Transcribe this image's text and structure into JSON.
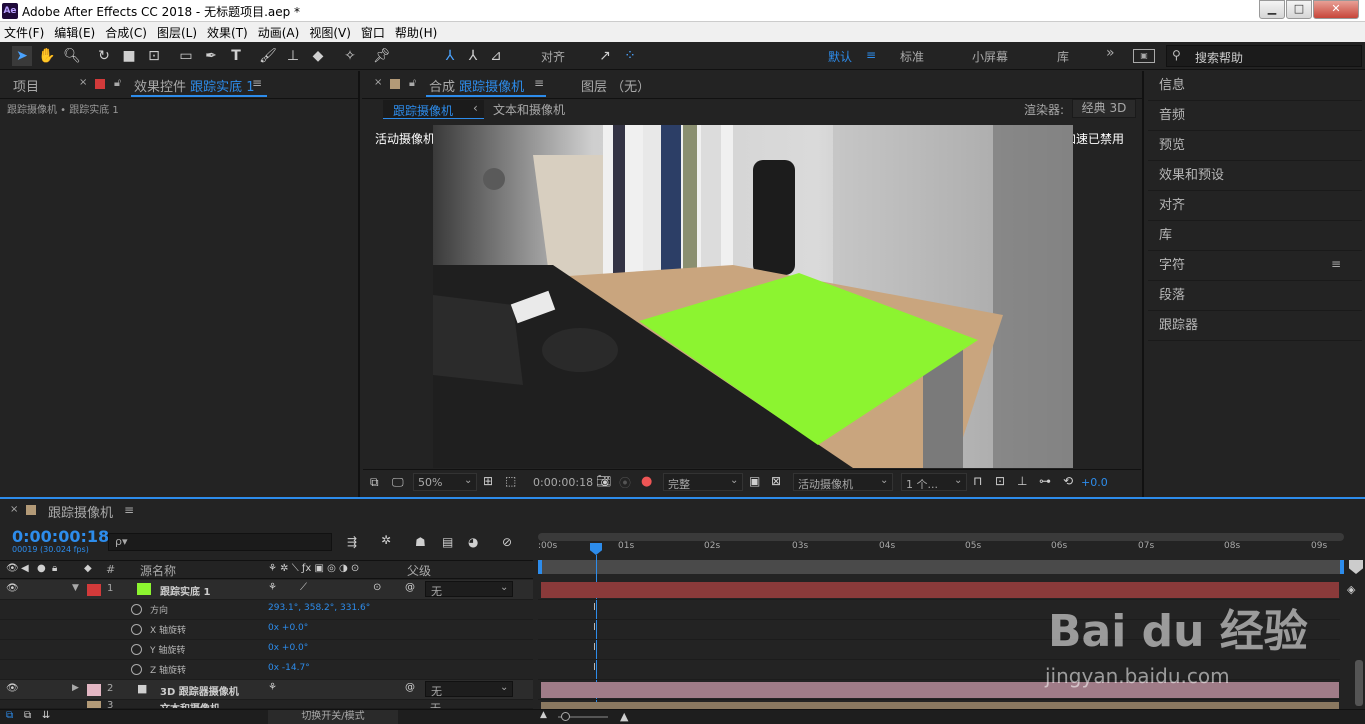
{
  "titlebar": {
    "app_icon": "Ae",
    "title": "Adobe After Effects CC 2018 - 无标题项目.aep *",
    "minimize": "▁",
    "maximize": "□",
    "close": "✕"
  },
  "menubar": {
    "items": [
      "文件(F)",
      "编辑(E)",
      "合成(C)",
      "图层(L)",
      "效果(T)",
      "动画(A)",
      "视图(V)",
      "窗口",
      "帮助(H)"
    ]
  },
  "toolbar": {
    "align_label": "对齐",
    "workspaces": [
      "默认",
      "标准",
      "小屏幕",
      "库"
    ],
    "more": "»",
    "search_placeholder": "搜索帮助"
  },
  "left_panel": {
    "tab_project": "项目",
    "tab_effects_prefix": "效果控件",
    "tab_effects_layer": "跟踪实底 1",
    "breadcrumb": "跟踪摄像机 • 跟踪实底 1"
  },
  "comp_panel": {
    "tab_prefix": "合成",
    "tab_name": "跟踪摄像机",
    "tab_layer": "图层 （无）",
    "sub_tab_active": "跟踪摄像机",
    "sub_tab_other": "文本和摄像机",
    "renderer_label": "渲染器:",
    "renderer_value": "经典 3D",
    "overlay_left": "活动摄像机",
    "overlay_right": "显示加速已禁用",
    "zoom": "50%",
    "timecode": "0:00:00:18",
    "quality": "完整",
    "camera": "活动摄像机",
    "views": "1 个...",
    "exposure": "+0.0"
  },
  "right_panel": {
    "items": [
      "信息",
      "音频",
      "预览",
      "效果和预设",
      "对齐",
      "库",
      "字符",
      "段落",
      "跟踪器"
    ]
  },
  "timeline": {
    "tab_name": "跟踪摄像机",
    "timecode": "0:00:00:18",
    "frame_info": "00019 (30.024 fps)",
    "search_placeholder": "ρ▾",
    "col_num": "#",
    "col_source": "源名称",
    "col_parent": "父级",
    "ruler": [
      ":00s",
      "01s",
      "02s",
      "03s",
      "04s",
      "05s",
      "06s",
      "07s",
      "08s",
      "09s"
    ],
    "layer1": {
      "num": "1",
      "name": "跟踪实底 1",
      "parent": "无"
    },
    "props": [
      {
        "name": "方向",
        "value": "293.1°, 358.2°, 331.6°"
      },
      {
        "name": "X 轴旋转",
        "value": "0x +0.0°"
      },
      {
        "name": "Y 轴旋转",
        "value": "0x +0.0°"
      },
      {
        "name": "Z 轴旋转",
        "value": "0x -14.7°"
      }
    ],
    "layer2": {
      "num": "2",
      "name": "3D 跟踪器摄像机",
      "parent": "无"
    },
    "layer3": {
      "num": "3",
      "name": "文本和摄像机",
      "parent": "无"
    },
    "footer_toggle": "切换开关/模式"
  },
  "watermark": {
    "brand": "Bai du 经验",
    "url": "jingyan.baidu.com"
  },
  "colors": {
    "accent": "#2d8ceb",
    "green_solid": "#8cf430",
    "layer1_bar": "#8a3a3a",
    "layer2_bar": "#a07c88"
  }
}
